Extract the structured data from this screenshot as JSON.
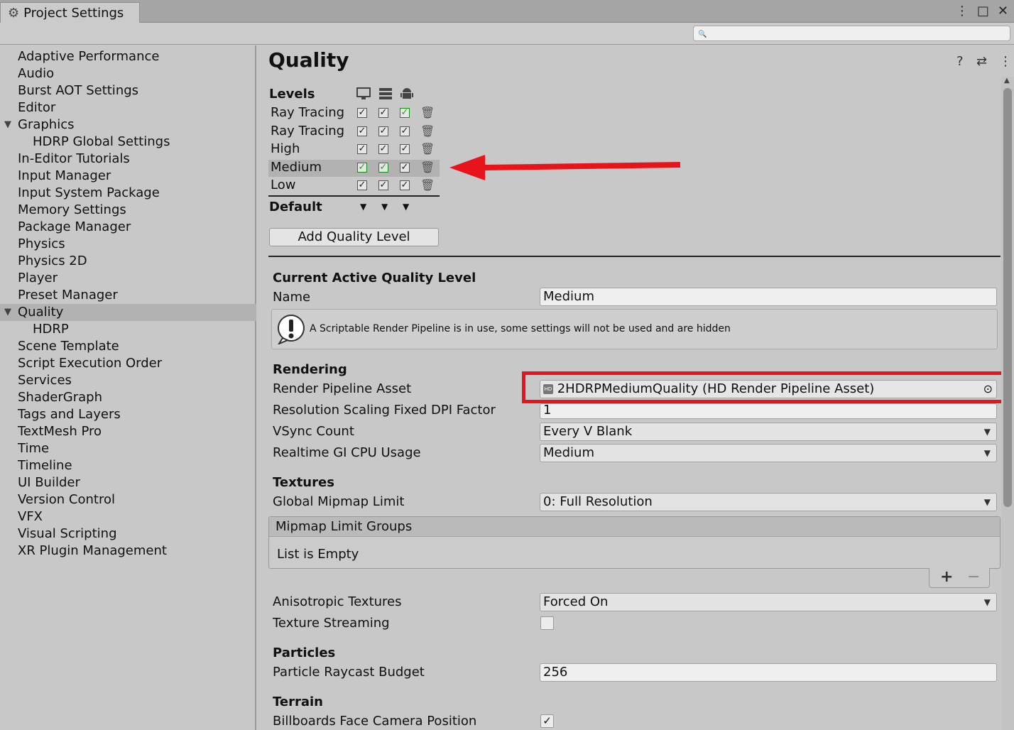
{
  "window": {
    "tab_title": "Project Settings",
    "tab_icon": "gear-icon",
    "more_glyph": "⋮",
    "maximize_glyph": "□",
    "close_glyph": "✕"
  },
  "search": {
    "glyph": "🔍",
    "value": ""
  },
  "sidebar": {
    "items": [
      {
        "label": "Adaptive Performance"
      },
      {
        "label": "Audio"
      },
      {
        "label": "Burst AOT Settings"
      },
      {
        "label": "Editor"
      },
      {
        "label": "Graphics",
        "expanded": true
      },
      {
        "label": "HDRP Global Settings",
        "child": true
      },
      {
        "label": "In-Editor Tutorials"
      },
      {
        "label": "Input Manager"
      },
      {
        "label": "Input System Package"
      },
      {
        "label": "Memory Settings"
      },
      {
        "label": "Package Manager"
      },
      {
        "label": "Physics"
      },
      {
        "label": "Physics 2D"
      },
      {
        "label": "Player"
      },
      {
        "label": "Preset Manager"
      },
      {
        "label": "Quality",
        "expanded": true,
        "selected": true
      },
      {
        "label": "HDRP",
        "child": true
      },
      {
        "label": "Scene Template"
      },
      {
        "label": "Script Execution Order"
      },
      {
        "label": "Services"
      },
      {
        "label": "ShaderGraph"
      },
      {
        "label": "Tags and Layers"
      },
      {
        "label": "TextMesh Pro"
      },
      {
        "label": "Time"
      },
      {
        "label": "Timeline"
      },
      {
        "label": "UI Builder"
      },
      {
        "label": "Version Control"
      },
      {
        "label": "VFX"
      },
      {
        "label": "Visual Scripting"
      },
      {
        "label": "XR Plugin Management"
      }
    ]
  },
  "main": {
    "title": "Quality",
    "header_icons": {
      "help": "?",
      "presets": "⇄",
      "more": "⋮"
    },
    "levels": {
      "label": "Levels",
      "platform_icons": [
        "monitor-icon",
        "server-icon",
        "android-icon"
      ],
      "rows": [
        {
          "name": "Ray Tracing (",
          "checks": [
            true,
            true,
            true
          ],
          "green": [
            false,
            false,
            true
          ]
        },
        {
          "name": "Ray Tracing",
          "checks": [
            true,
            true,
            true
          ],
          "green": [
            false,
            false,
            false
          ]
        },
        {
          "name": "High",
          "checks": [
            true,
            true,
            true
          ],
          "green": [
            false,
            false,
            false
          ]
        },
        {
          "name": "Medium",
          "checks": [
            true,
            true,
            true
          ],
          "green": [
            true,
            true,
            false
          ],
          "selected": true
        },
        {
          "name": "Low",
          "checks": [
            true,
            true,
            true
          ],
          "green": [
            false,
            false,
            false
          ]
        }
      ],
      "default_label": "Default",
      "add_button": "Add Quality Level"
    },
    "current": {
      "header": "Current Active Quality Level",
      "name_label": "Name",
      "name_value": "Medium",
      "help_text": "A Scriptable Render Pipeline is in use, some settings will not be used and are hidden"
    },
    "rendering": {
      "header": "Rendering",
      "rp_asset_label": "Render Pipeline Asset",
      "rp_asset_value": "2HDRPMediumQuality (HD Render Pipeline Asset)",
      "dpi_label": "Resolution Scaling Fixed DPI Factor",
      "dpi_value": "1",
      "vsync_label": "VSync Count",
      "vsync_value": "Every V Blank",
      "gi_label": "Realtime GI CPU Usage",
      "gi_value": "Medium"
    },
    "textures": {
      "header": "Textures",
      "mipmap_label": "Global Mipmap Limit",
      "mipmap_value": "0: Full Resolution",
      "groups_header": "Mipmap Limit Groups",
      "groups_empty": "List is Empty",
      "add_glyph": "+",
      "remove_glyph": "−",
      "aniso_label": "Anisotropic Textures",
      "aniso_value": "Forced On",
      "streaming_label": "Texture Streaming",
      "streaming_checked": false
    },
    "particles": {
      "header": "Particles",
      "raycast_label": "Particle Raycast Budget",
      "raycast_value": "256"
    },
    "terrain": {
      "header": "Terrain",
      "billboards_label": "Billboards Face Camera Position",
      "billboards_checked": true
    }
  },
  "annotations": {
    "arrow_color": "#e8141c",
    "box_color": "#e8141c"
  }
}
